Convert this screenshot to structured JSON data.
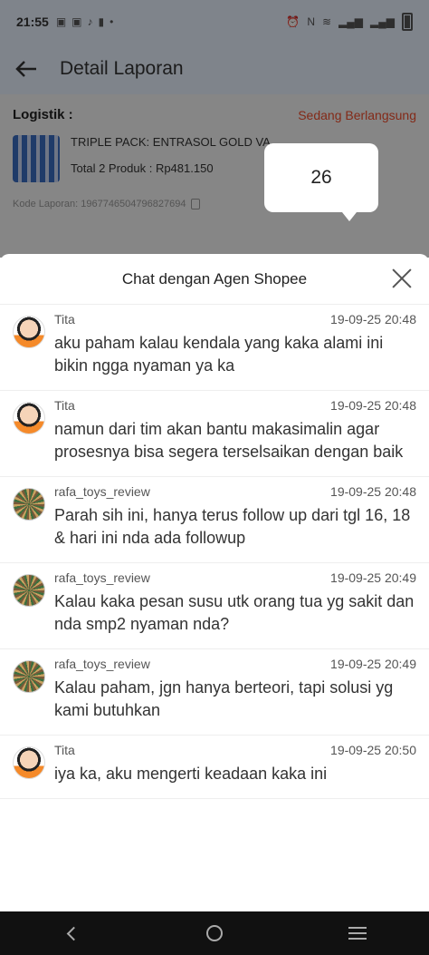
{
  "status_bar": {
    "time": "21:55",
    "left_icons": [
      "notification-icon",
      "notification-icon",
      "tiktok-icon",
      "battery-saver-icon"
    ],
    "right_icons": [
      "alarm-icon",
      "nfc-icon",
      "volte-icon",
      "wifi-icon",
      "signal-icon",
      "signal-icon",
      "battery-icon"
    ]
  },
  "header": {
    "title": "Detail Laporan"
  },
  "report": {
    "section_label": "Logistik :",
    "status": "Sedang Berlangsung",
    "product_name": "TRIPLE PACK: ENTRASOL GOLD VA",
    "product_total": "Total 2 Produk : Rp481.150",
    "kode": "Kode Laporan: 1967746504796827694"
  },
  "tooltip": {
    "value": "26"
  },
  "chat": {
    "title": "Chat dengan Agen Shopee",
    "messages": [
      {
        "sender": "Tita",
        "time": "19-09-25 20:48",
        "text": "aku paham kalau kendala yang kaka alami ini bikin ngga nyaman ya ka",
        "avatar": "agent"
      },
      {
        "sender": "Tita",
        "time": "19-09-25 20:48",
        "text": "namun dari tim akan bantu makasimalin agar prosesnya bisa segera terselsaikan dengan baik",
        "avatar": "agent"
      },
      {
        "sender": "rafa_toys_review",
        "time": "19-09-25 20:48",
        "text": "Parah sih ini, hanya terus follow up dari tgl 16, 18 & hari ini nda ada followup",
        "avatar": "user"
      },
      {
        "sender": "rafa_toys_review",
        "time": "19-09-25 20:49",
        "text": "Kalau kaka pesan susu utk orang tua yg sakit dan nda smp2 nyaman nda?",
        "avatar": "user"
      },
      {
        "sender": "rafa_toys_review",
        "time": "19-09-25 20:49",
        "text": "Kalau paham, jgn hanya berteori, tapi solusi yg kami butuhkan",
        "avatar": "user"
      },
      {
        "sender": "Tita",
        "time": "19-09-25 20:50",
        "text": "iya ka, aku mengerti keadaan kaka ini",
        "avatar": "agent"
      }
    ]
  }
}
